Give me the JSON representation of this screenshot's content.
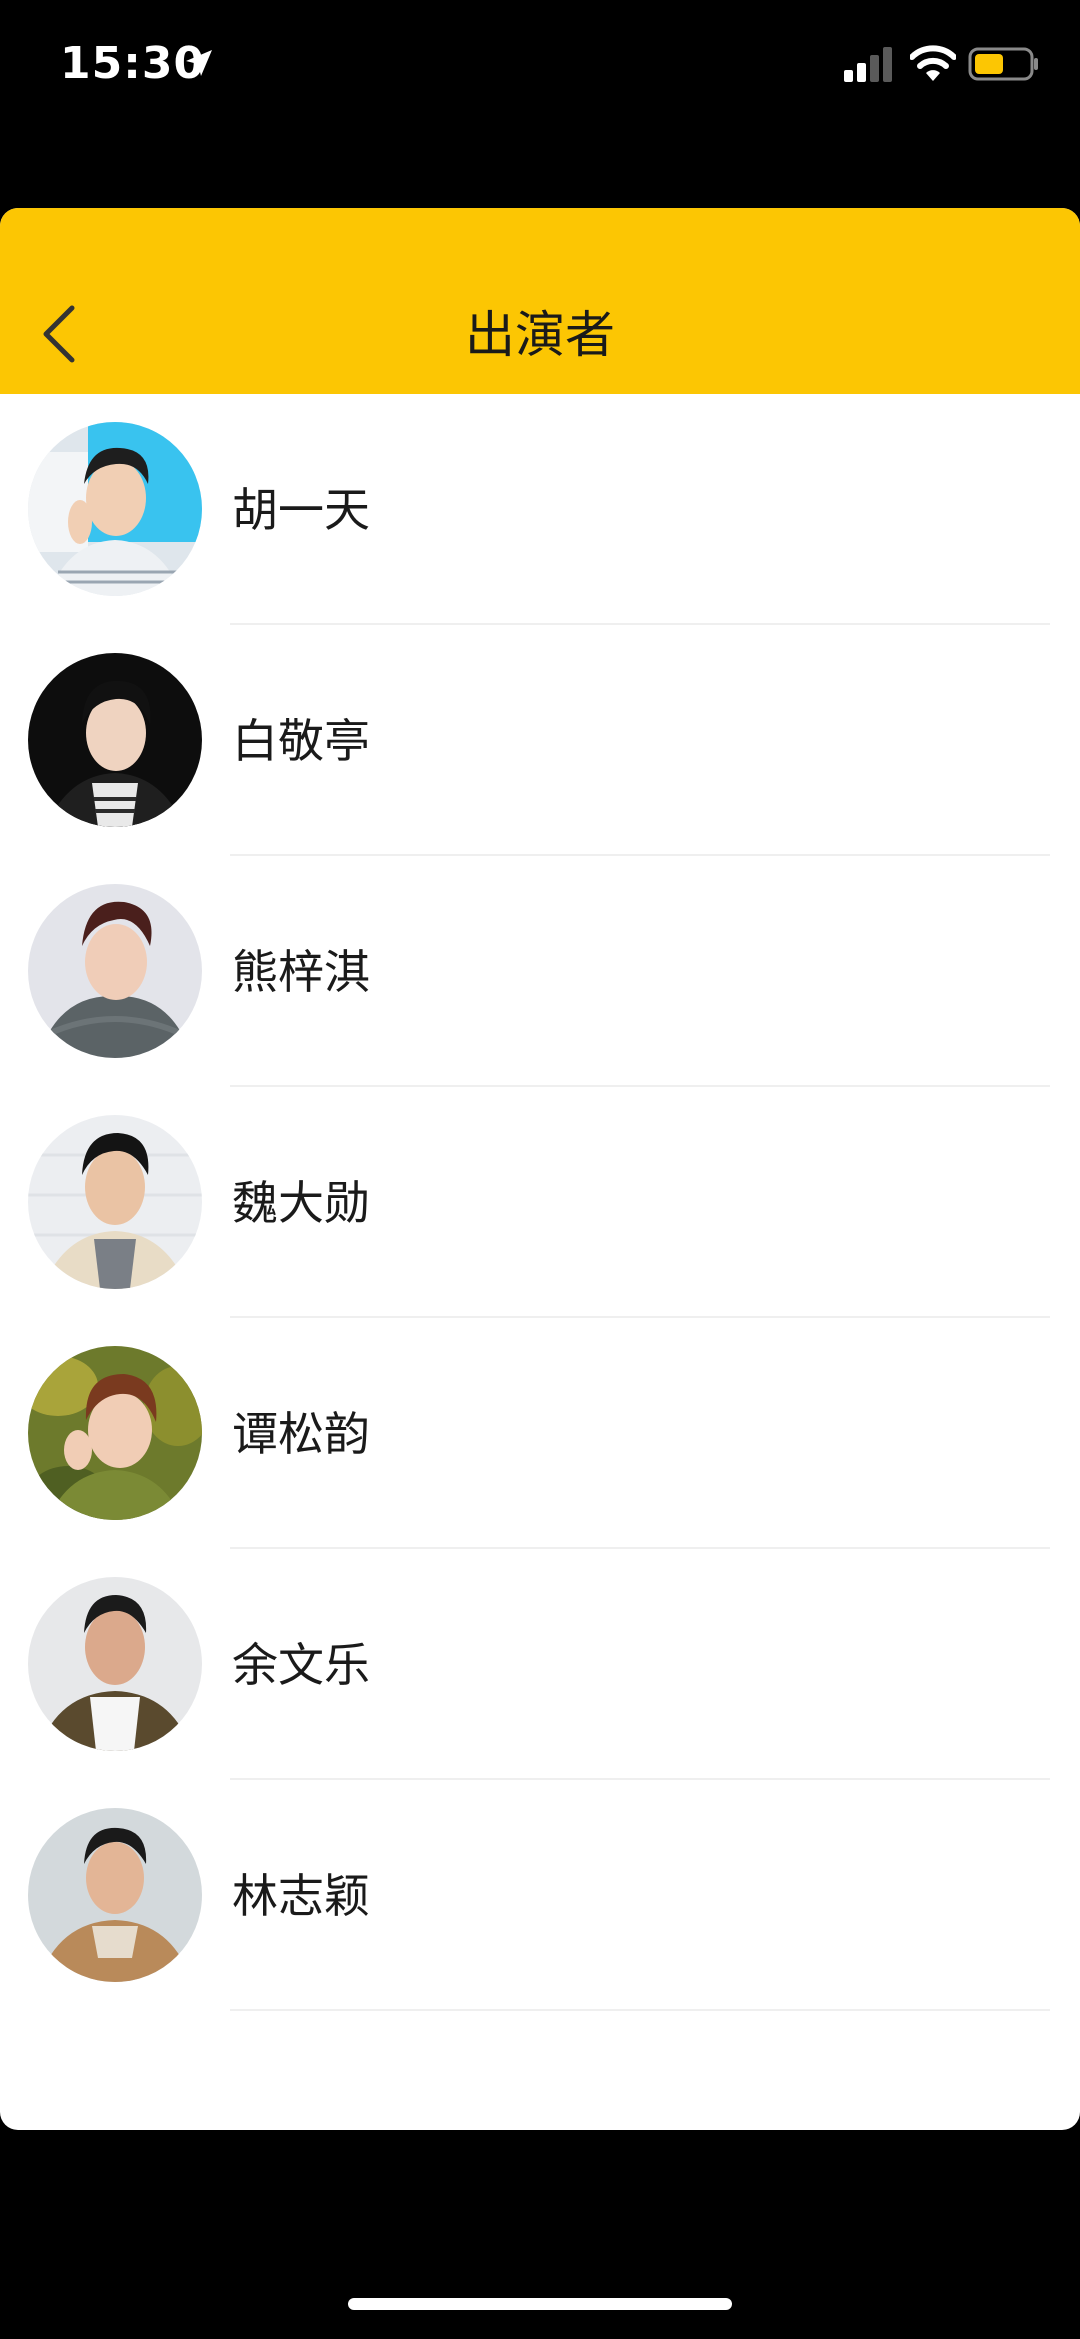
{
  "status_bar": {
    "time": "15:30",
    "icons": [
      "location-arrow-icon",
      "cellular-signal-icon",
      "wifi-icon",
      "battery-icon"
    ],
    "battery_color": "#fcc603"
  },
  "nav": {
    "title": "出演者",
    "back_icon": "chevron-left-icon",
    "background_color": "#fcc603"
  },
  "cast": [
    {
      "name": "胡一天"
    },
    {
      "name": "白敬亭"
    },
    {
      "name": "熊梓淇"
    },
    {
      "name": "魏大勋"
    },
    {
      "name": "谭松韵"
    },
    {
      "name": "余文乐"
    },
    {
      "name": "林志颖"
    }
  ]
}
